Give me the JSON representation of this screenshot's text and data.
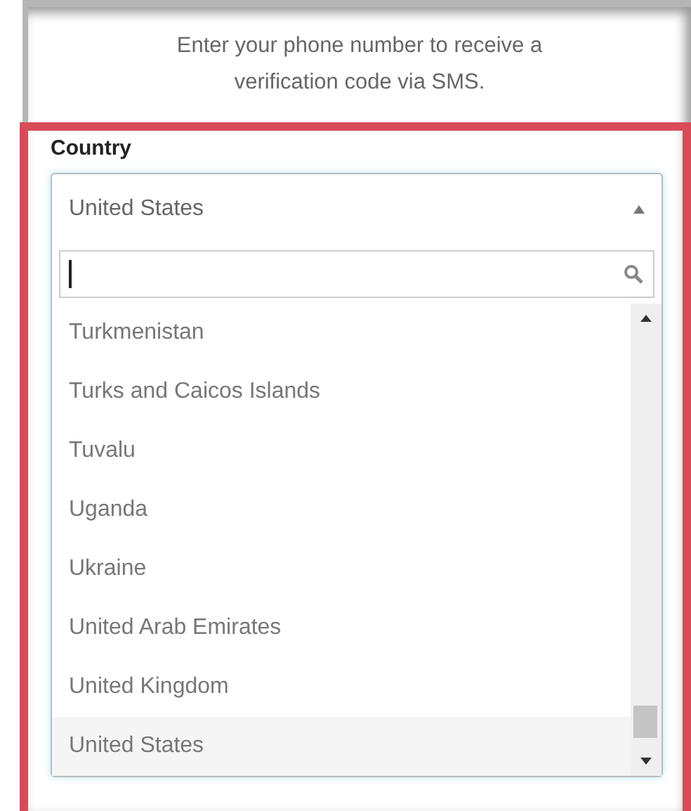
{
  "intro": "Enter your phone number to receive a verification code via SMS.",
  "country": {
    "label": "Country",
    "value": "United States",
    "expanded": true,
    "options": [
      {
        "label": "Turkmenistan",
        "selected": false
      },
      {
        "label": "Turks and Caicos Islands",
        "selected": false
      },
      {
        "label": "Tuvalu",
        "selected": false
      },
      {
        "label": "Uganda",
        "selected": false
      },
      {
        "label": "Ukraine",
        "selected": false
      },
      {
        "label": "United Arab Emirates",
        "selected": false
      },
      {
        "label": "United Kingdom",
        "selected": false
      },
      {
        "label": "United States",
        "selected": true
      }
    ]
  }
}
